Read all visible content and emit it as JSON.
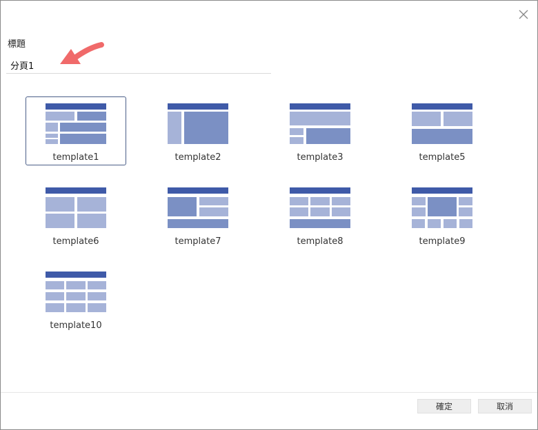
{
  "dialog": {
    "title_label": "標題",
    "title_value": "分頁1",
    "close_icon": "close-icon"
  },
  "templates": [
    {
      "label": "template1",
      "selected": true
    },
    {
      "label": "template2",
      "selected": false
    },
    {
      "label": "template3",
      "selected": false
    },
    {
      "label": "template5",
      "selected": false
    },
    {
      "label": "template6",
      "selected": false
    },
    {
      "label": "template7",
      "selected": false
    },
    {
      "label": "template8",
      "selected": false
    },
    {
      "label": "template9",
      "selected": false
    },
    {
      "label": "template10",
      "selected": false
    }
  ],
  "buttons": {
    "confirm": "確定",
    "cancel": "取消"
  },
  "colors": {
    "header_bar": "#3f5aa8",
    "block_dark": "#7b90c4",
    "block_light": "#a6b3d8",
    "arrow": "#f06a6a"
  }
}
